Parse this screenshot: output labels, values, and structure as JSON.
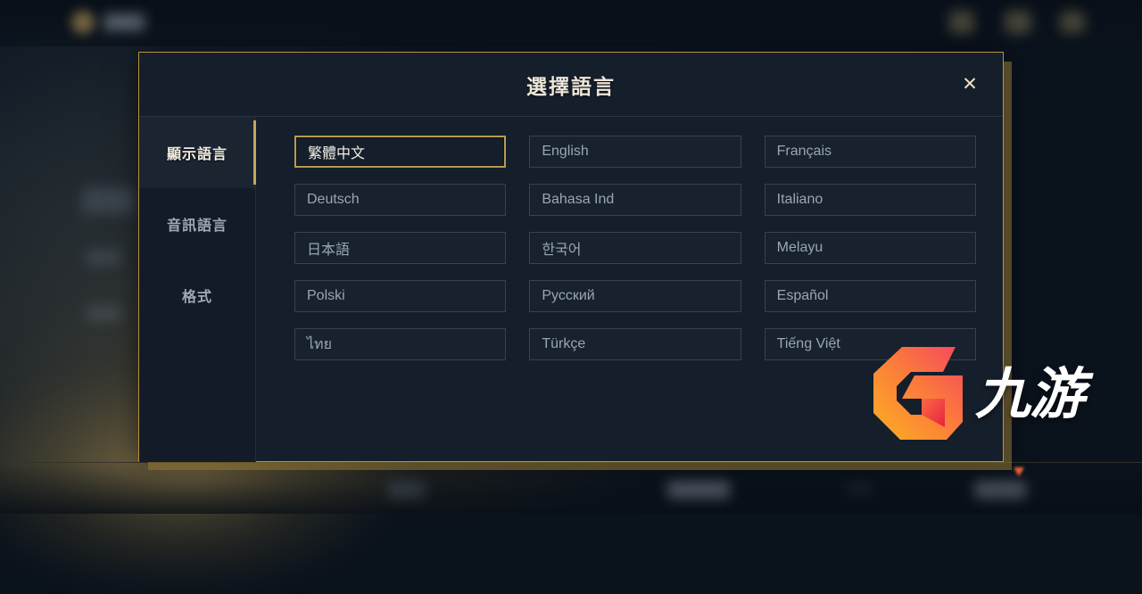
{
  "background": {
    "topbar": {
      "back_icon": "back-arrow-icon",
      "title_blob": "blurred-screen-title"
    },
    "topbar_icons": [
      "blurred-icon-1",
      "blurred-icon-2",
      "blurred-icon-3"
    ],
    "bottombar_blobs": [
      "blurred-label-1",
      "blurred-label-2",
      "blurred-label-3",
      "blurred-label-4"
    ],
    "side_blobs": [
      "blurred-menu-1",
      "blurred-menu-2",
      "blurred-menu-3"
    ]
  },
  "dialog": {
    "title": "選擇語言",
    "close_label": "✕",
    "sidebar": {
      "items": [
        {
          "label": "顯示語言",
          "active": true
        },
        {
          "label": "音訊語言",
          "active": false
        },
        {
          "label": "格式",
          "active": false
        }
      ]
    },
    "options": [
      {
        "label": "繁體中文",
        "selected": true
      },
      {
        "label": "English",
        "selected": false
      },
      {
        "label": "Français",
        "selected": false
      },
      {
        "label": "Deutsch",
        "selected": false
      },
      {
        "label": "Bahasa Ind",
        "selected": false
      },
      {
        "label": "Italiano",
        "selected": false
      },
      {
        "label": "日本語",
        "selected": false
      },
      {
        "label": "한국어",
        "selected": false
      },
      {
        "label": "Melayu",
        "selected": false
      },
      {
        "label": "Polski",
        "selected": false
      },
      {
        "label": "Русский",
        "selected": false
      },
      {
        "label": "Español",
        "selected": false
      },
      {
        "label": "ไทย",
        "selected": false
      },
      {
        "label": "Türkçe",
        "selected": false
      },
      {
        "label": "Tiếng Việt",
        "selected": false
      }
    ]
  },
  "watermark": {
    "mark": "jiuyou-logo-mark",
    "text": "九游"
  },
  "colors": {
    "accent_gold": "#b6943f",
    "active_gold": "#c7a556",
    "dialog_bg": "#151e2b",
    "option_text": "#9aa6b4",
    "selected_text": "#f2efe7",
    "watermark_orange": "#fb9d2b",
    "watermark_red": "#f4475f"
  }
}
